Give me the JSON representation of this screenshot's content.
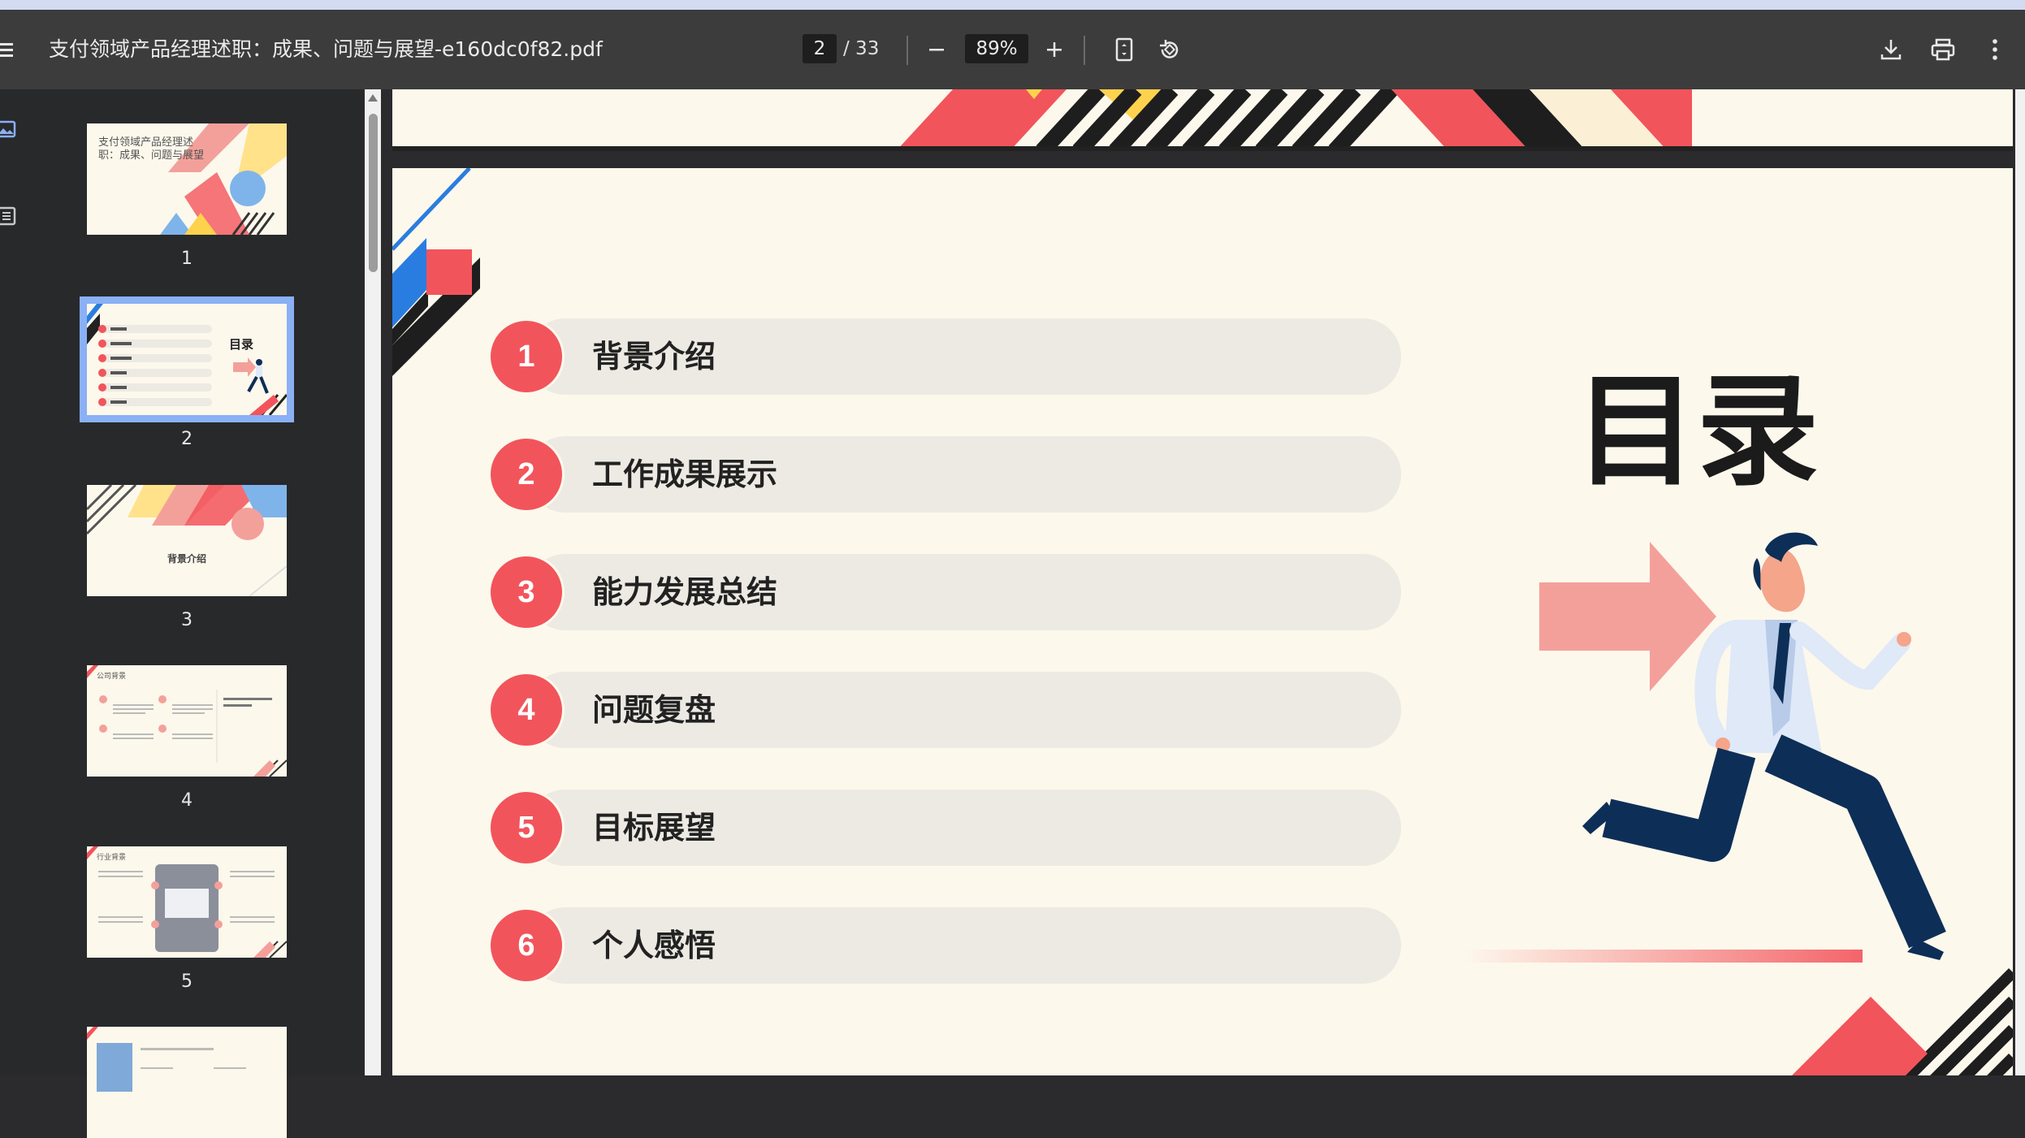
{
  "toolbar": {
    "file_title": "支付领域产品经理述职：成果、问题与展望-e160dc0f82.pdf",
    "current_page": "2",
    "page_total": "/ 33",
    "zoom": "89%",
    "icons": [
      "menu-icon",
      "zoom-out-icon",
      "zoom-in-icon",
      "fit-page-icon",
      "rotate-icon",
      "download-icon",
      "print-icon",
      "more-icon"
    ]
  },
  "sidebar": {
    "nav_icons": [
      "thumbnails-icon",
      "outline-icon"
    ],
    "thumbnails": [
      {
        "number": "1",
        "title": "支付领域产品经理述职：成果、问题与展望"
      },
      {
        "number": "2",
        "title": "目录"
      },
      {
        "number": "3",
        "title": "背景介绍"
      },
      {
        "number": "4",
        "title": "公司背景"
      },
      {
        "number": "5",
        "title": "行业背景"
      }
    ],
    "selected": "2"
  },
  "page": {
    "title": "目录",
    "items": [
      {
        "num": "1",
        "label": "背景介绍"
      },
      {
        "num": "2",
        "label": "工作成果展示"
      },
      {
        "num": "3",
        "label": "能力发展总结"
      },
      {
        "num": "4",
        "label": "问题复盘"
      },
      {
        "num": "5",
        "label": "目标展望"
      },
      {
        "num": "6",
        "label": "个人感悟"
      }
    ]
  },
  "colors": {
    "accent_red": "#f2545b",
    "pill_bg": "#eceae3",
    "page_bg": "#fdf8ec",
    "toolbar_bg": "#3c3c3c",
    "sidebar_bg": "#28292b",
    "selection": "#8ab0f5",
    "navy": "#0d2e57",
    "pink_arrow": "#f4a09a",
    "yellow": "#ffd24d",
    "blue_stripe": "#2a7de0"
  }
}
